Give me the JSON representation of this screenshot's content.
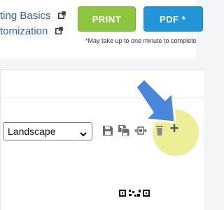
{
  "links": [
    {
      "label": "ting Basics"
    },
    {
      "label": "tomization"
    }
  ],
  "buttons": {
    "print": "PRINT",
    "pdf": "PDF *"
  },
  "note": "*May take up to one minute to complete",
  "orientation": {
    "selected": "Landscape"
  },
  "icons": [
    "external-link-icon",
    "save-icon",
    "save-copy-icon",
    "reorder-icon",
    "trash-icon",
    "add-icon"
  ],
  "colors": {
    "link": "#2f5fb5",
    "print_button": "#8cc63f",
    "pdf_button": "#2196d9",
    "highlight": "#ececa0",
    "arrow": "#4a86d9"
  }
}
